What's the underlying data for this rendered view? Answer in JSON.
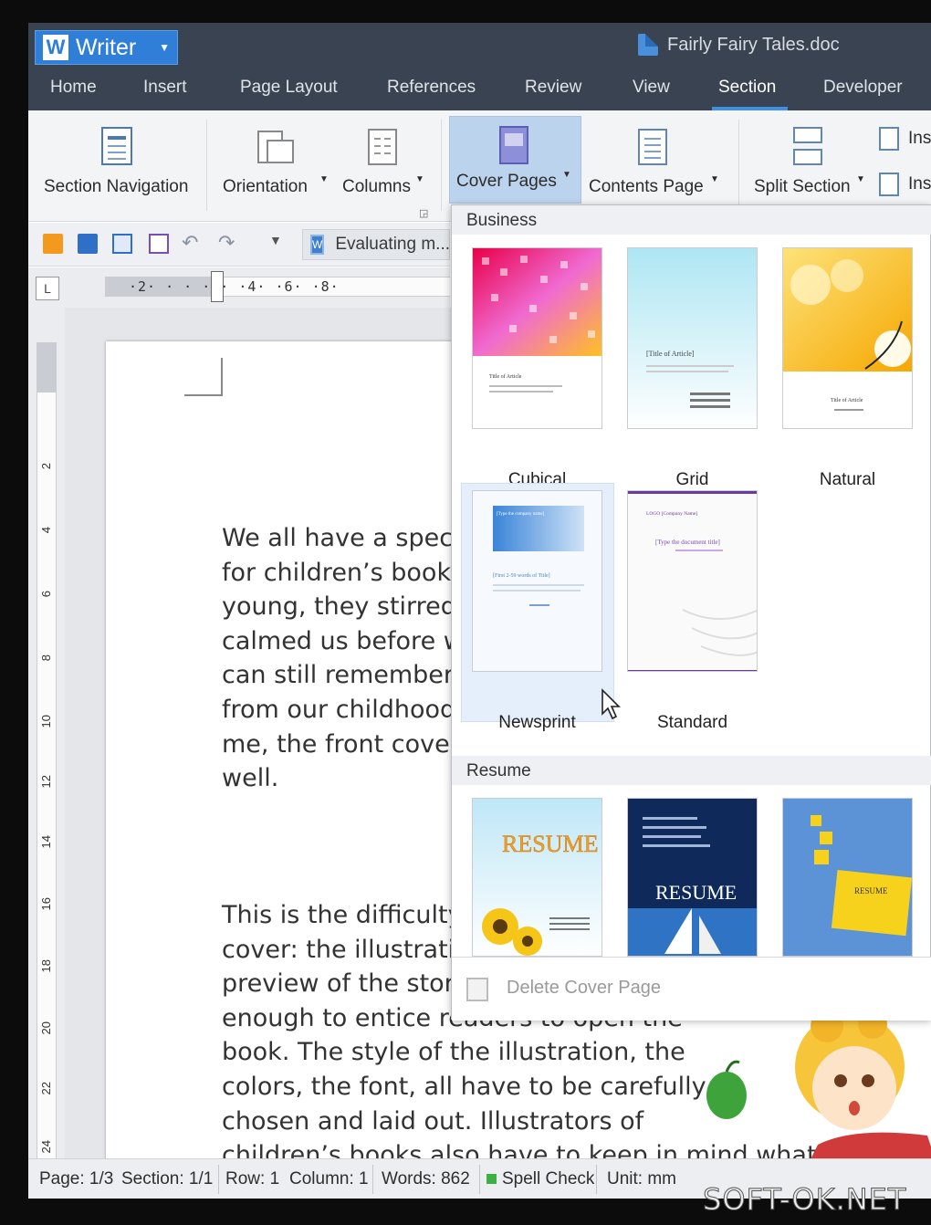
{
  "app": {
    "name": "Writer",
    "document_title": "Fairly Fairy Tales.doc"
  },
  "menu": [
    "Home",
    "Insert",
    "Page Layout",
    "References",
    "Review",
    "View",
    "Section",
    "Developer"
  ],
  "active_menu": "Section",
  "ribbon": {
    "section_navigation": "Section Navigation",
    "orientation": "Orientation",
    "columns": "Columns",
    "cover_pages": "Cover Pages",
    "contents_page": "Contents Page",
    "split_section": "Split Section",
    "ins_top": "Ins",
    "ins_bottom": "Ins"
  },
  "quickbar": {
    "document_tab": "Evaluating m..."
  },
  "ruler": {
    "corner": "L",
    "h_ticks": "·2·  · · ·2· ·4· ·6· ·8·",
    "v_numbers": [
      "2",
      "4",
      "6",
      "8",
      "10",
      "12",
      "14",
      "16",
      "18",
      "20",
      "22",
      "24"
    ]
  },
  "document": {
    "para1": [
      "We all have a special",
      "for children’s books. \\",
      "young, they stirred ou",
      "calmed us before we",
      "can still remember m",
      "from our childhood, a",
      "me, the front cover o",
      "well."
    ],
    "para2": [
      "This is the difficulty of",
      "cover: the illustration",
      "preview of the story a",
      "enough to entice readers to open the",
      "book. The style of the illustration, the",
      "colors, the font, all have to be carefully",
      "chosen and laid out. Illustrators of",
      "children’s books also have to keep in mind what designs will appeal"
    ]
  },
  "gallery": {
    "business_header": "Business",
    "resume_header": "Resume",
    "business": [
      {
        "name": "Cubical",
        "thumb_text": "Title of Article"
      },
      {
        "name": "Grid",
        "thumb_text": "[Title of Article]"
      },
      {
        "name": "Natural",
        "thumb_text": "Title of Article"
      },
      {
        "name": "Newsprint",
        "thumb_text": "[First 2-59 words of Title]",
        "thumb_top": "[Type the company name]"
      },
      {
        "name": "Standard",
        "thumb_text": "[Type the document title]",
        "thumb_top": "LOGO [Company Name]"
      }
    ],
    "resume": [
      {
        "thumb_text": "RESUME"
      },
      {
        "thumb_text": "RESUME"
      },
      {
        "thumb_text": "RESUME"
      }
    ],
    "delete_label": "Delete Cover Page"
  },
  "status": {
    "page": "Page: 1/3",
    "section": "Section: 1/1",
    "row": "Row: 1",
    "column": "Column: 1",
    "words": "Words: 862",
    "spell": "Spell Check",
    "unit": "Unit: mm"
  },
  "watermark": "SOFT-OK.NET",
  "colors": {
    "titlebar": "#3a4352",
    "accent": "#2f7ed8",
    "hover": "#e5eefb"
  }
}
